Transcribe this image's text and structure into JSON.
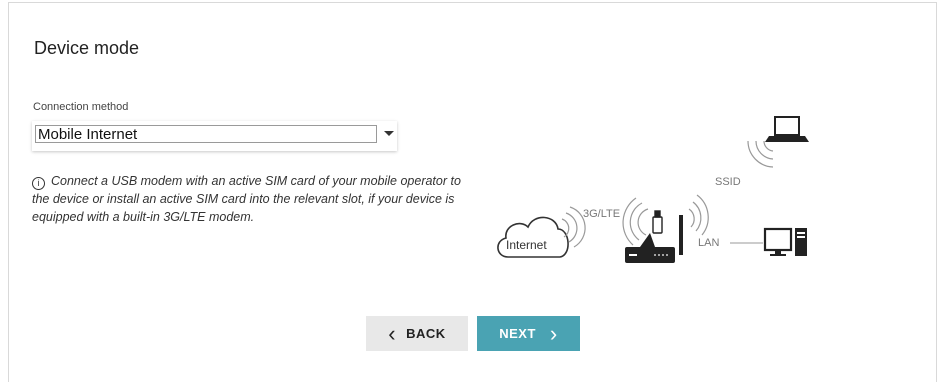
{
  "page": {
    "title": "Device mode"
  },
  "connection": {
    "label": "Connection method",
    "selected": "Mobile Internet"
  },
  "hint": {
    "icon": "info-icon",
    "text": "Connect a USB modem with an active SIM card of your mobile operator to the device or install an active SIM card into the relevant slot, if your device is equipped with a built-in 3G/LTE modem."
  },
  "diagram": {
    "internet_label": "Internet",
    "link_3g_label": "3G/LTE",
    "ssid_label": "SSID",
    "lan_label": "LAN"
  },
  "buttons": {
    "back_label": "BACK",
    "next_label": "NEXT"
  },
  "colors": {
    "next_bg": "#4aa3b3",
    "back_bg": "#e8e8e8"
  }
}
